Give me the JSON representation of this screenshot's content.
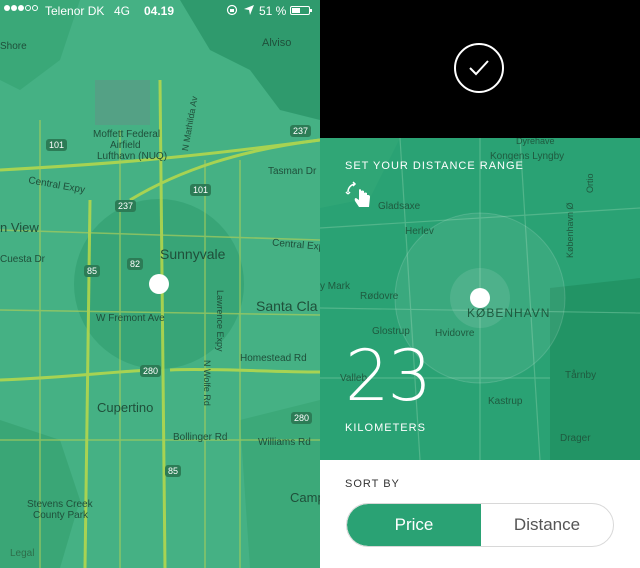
{
  "status_bar": {
    "carrier": "Telenor DK",
    "network": "4G",
    "time": "04.19",
    "battery": "51 %"
  },
  "left_map": {
    "legal": "Legal",
    "labels": {
      "alviso": "Alviso",
      "moffett": "Moffett Federal",
      "airfield": "Airfield",
      "lufthavn": "Lufthavn (NUQ)",
      "central_expy": "Central Expy",
      "central_expy2": "Central Expy",
      "view": "n View",
      "cuesta": "Cuesta Dr",
      "sunnyvale": "Sunnyvale",
      "santa_cla": "Santa Cla",
      "fremont": "W Fremont Ave",
      "homestead": "Homestead Rd",
      "cupertino": "Cupertino",
      "bollinger": "Bollinger Rd",
      "williams": "Williams Rd",
      "stevens": "Stevens Creek",
      "county_park": "County Park",
      "camp": "Camp",
      "lawrence": "Lawrence Expy",
      "mathilda": "N Mathilda Av",
      "wolfe": "N Wolfe Rd",
      "tasman": "Tasman Dr",
      "shore": "Shore"
    },
    "shields": {
      "s101a": "101",
      "s101b": "101",
      "s237a": "237",
      "s237b": "237",
      "s85a": "85",
      "s85b": "85",
      "s82": "82",
      "s280": "280",
      "s280b": "280"
    }
  },
  "right_map": {
    "labels": {
      "dyrehave": "Dyrehave",
      "kongens": "Kongens Lyngby",
      "gladsaxe": "Gladsaxe",
      "herlev": "Herlev",
      "rodovre": "Rødovre",
      "glostrup": "Glostrup",
      "hvidovre": "Hvidovre",
      "valleb": "Valleb",
      "kobenhavn": "KØBENHAVN",
      "kastrup": "Kastrup",
      "tarnby": "Tårnby",
      "drager": "Drager",
      "mark": "y Mark",
      "kobenhavn_o": "København Ø",
      "ortho": "Ortio"
    }
  },
  "confirm": {
    "icon": "checkmark-icon"
  },
  "range": {
    "title": "SET YOUR DISTANCE RANGE",
    "gesture_icon": "pinch-gesture-icon",
    "value": "23",
    "unit": "KILOMETERS"
  },
  "sort": {
    "title": "SORT BY",
    "options": [
      "Price",
      "Distance"
    ],
    "selected": "Price"
  },
  "colors": {
    "accent": "#2aa274",
    "map_tint": "#3fb07f"
  }
}
